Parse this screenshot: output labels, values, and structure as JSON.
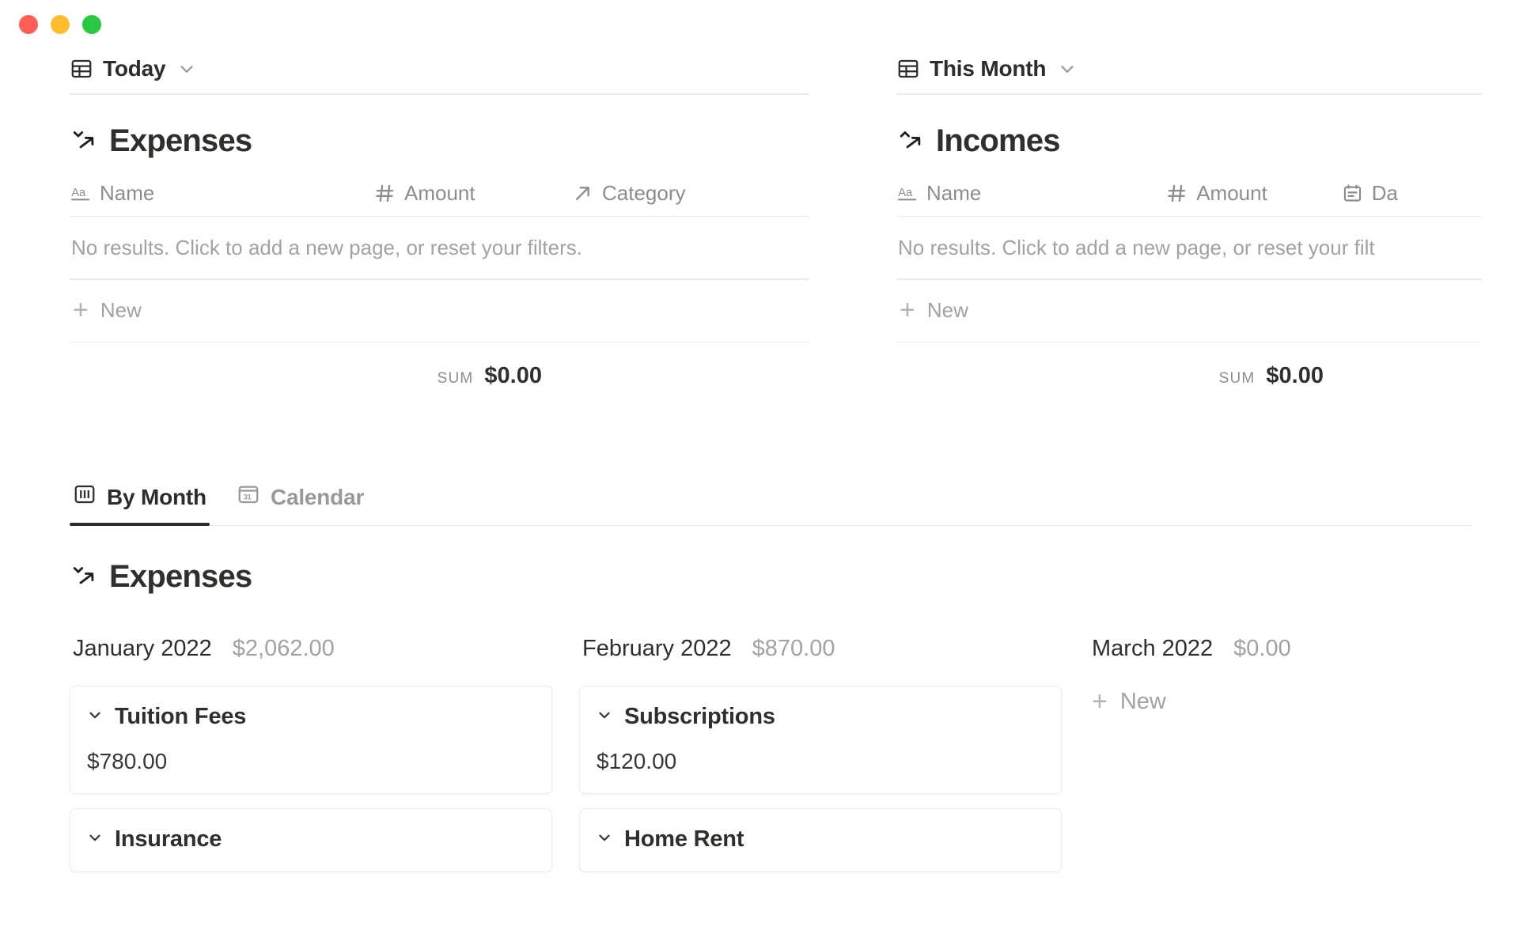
{
  "window": {
    "controls": [
      {
        "name": "close",
        "color": "#ff5f57"
      },
      {
        "name": "minimize",
        "color": "#ffbd2e"
      },
      {
        "name": "maximize",
        "color": "#28c840"
      }
    ]
  },
  "top_panels": {
    "expenses": {
      "view_tab_label": "Today",
      "database_title": "Expenses",
      "columns": [
        {
          "label": "Name",
          "icon": "text-icon"
        },
        {
          "label": "Amount",
          "icon": "number-icon"
        },
        {
          "label": "Category",
          "icon": "relation-icon"
        }
      ],
      "empty_message": "No results. Click to add a new page, or reset your filters.",
      "new_label": "New",
      "sum_label": "SUM",
      "sum_value": "$0.00"
    },
    "incomes": {
      "view_tab_label": "This Month",
      "database_title": "Incomes",
      "columns": [
        {
          "label": "Name",
          "icon": "text-icon"
        },
        {
          "label": "Amount",
          "icon": "number-icon"
        },
        {
          "label": "Da",
          "icon": "date-icon"
        }
      ],
      "empty_message": "No results. Click to add a new page, or reset your filt",
      "new_label": "New",
      "sum_label": "SUM",
      "sum_value": "$0.00"
    }
  },
  "board": {
    "tabs": [
      {
        "label": "By Month",
        "icon": "board-icon",
        "active": true
      },
      {
        "label": "Calendar",
        "icon": "calendar-icon",
        "active": false
      }
    ],
    "title": "Expenses",
    "columns": [
      {
        "name": "January 2022",
        "total": "$2,062.00",
        "cards": [
          {
            "title": "Tuition Fees",
            "amount": "$780.00"
          },
          {
            "title": "Insurance",
            "amount": ""
          }
        ],
        "new_label": ""
      },
      {
        "name": "February 2022",
        "total": "$870.00",
        "cards": [
          {
            "title": "Subscriptions",
            "amount": "$120.00"
          },
          {
            "title": "Home Rent",
            "amount": ""
          }
        ],
        "new_label": ""
      },
      {
        "name": "March 2022",
        "total": "$0.00",
        "cards": [],
        "new_label": "New"
      }
    ]
  }
}
